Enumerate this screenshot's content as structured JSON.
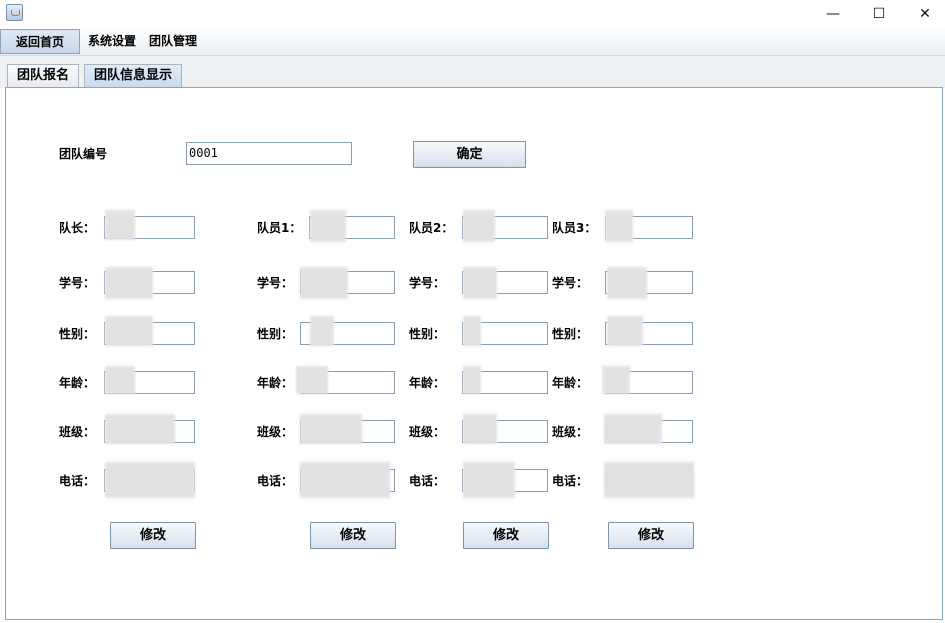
{
  "window": {
    "minimize_glyph": "—",
    "maximize_glyph": "☐",
    "close_glyph": "✕"
  },
  "menu": {
    "home": "返回首页",
    "settings": "系统设置",
    "team_mgmt": "团队管理"
  },
  "tabs": {
    "register": "团队报名",
    "info": "团队信息显示"
  },
  "query": {
    "label": "团队编号",
    "value": "0001",
    "confirm": "确定"
  },
  "columns": [
    {
      "title": "队长：",
      "edit": "修改"
    },
    {
      "title": "队员1：",
      "edit": "修改"
    },
    {
      "title": "队员2：",
      "edit": "修改"
    },
    {
      "title": "队员3：",
      "edit": "修改"
    }
  ],
  "field_labels": {
    "student_id": "学号：",
    "gender": "性别：",
    "age": "年龄：",
    "class": "班级：",
    "phone": "电话："
  }
}
